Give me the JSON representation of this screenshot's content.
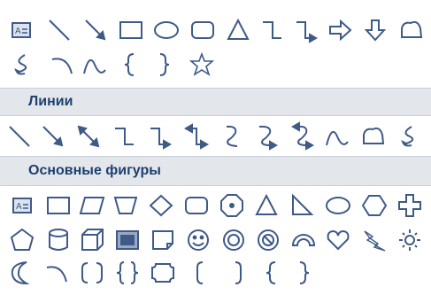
{
  "colors": {
    "header_background": "#e3e7ec",
    "header_text": "#1e3f6f",
    "shape_stroke": "#3f5a87"
  },
  "recent_shapes": {
    "items": [
      "text-box",
      "line",
      "arrow",
      "rectangle",
      "oval",
      "rounded-rectangle",
      "isosceles-triangle",
      "elbow-connector",
      "elbow-arrow-connector",
      "right-arrow",
      "down-arrow",
      "flowchart-stored-data",
      "freeform-scribble",
      "arc",
      "curve",
      "left-brace",
      "right-brace",
      "5-point-star"
    ]
  },
  "lines": {
    "header": "Линии",
    "items": [
      "line",
      "arrow",
      "double-arrow",
      "elbow-connector",
      "elbow-arrow-connector",
      "elbow-double-arrow-connector",
      "curved-connector",
      "curved-arrow-connector",
      "curved-double-arrow-connector",
      "curve",
      "freeform",
      "scribble"
    ]
  },
  "basic_shapes": {
    "header": "Основные фигуры",
    "items": [
      "text-box",
      "rectangle",
      "parallelogram",
      "trapezoid",
      "diamond",
      "rounded-rectangle",
      "octagon",
      "isosceles-triangle",
      "right-triangle",
      "oval",
      "hexagon",
      "cross",
      "pentagon",
      "can",
      "cube",
      "bevel",
      "folded-corner",
      "smiley-face",
      "donut",
      "no-symbol",
      "block-arc",
      "heart",
      "lightning-bolt",
      "sun",
      "moon",
      "arc",
      "double-bracket",
      "double-brace",
      "plaque",
      "left-bracket",
      "right-bracket",
      "left-brace",
      "right-brace"
    ]
  }
}
